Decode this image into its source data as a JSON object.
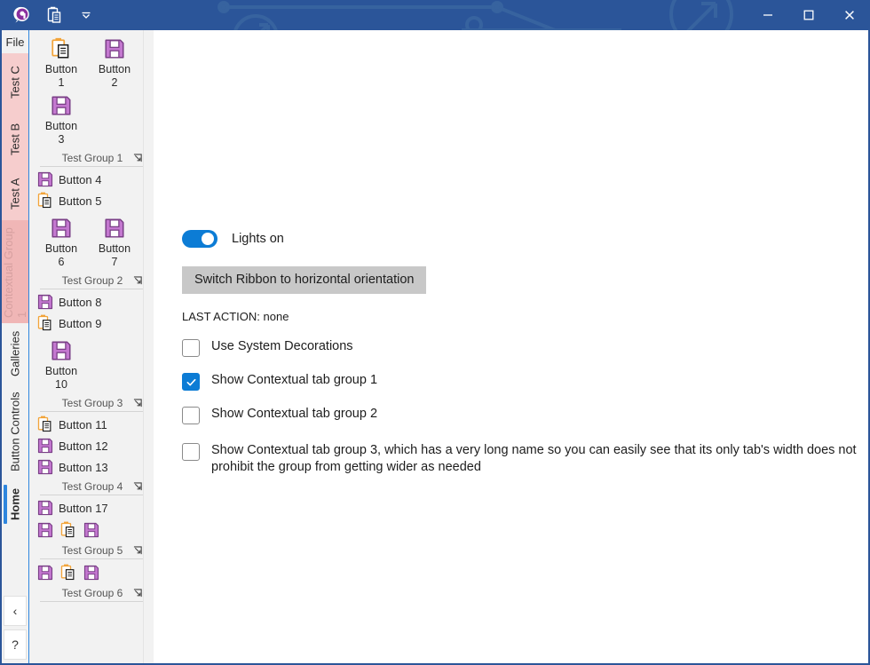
{
  "titlebar": {
    "app_icon": "app-logo-icon",
    "buttons": [
      {
        "name": "paste-icon",
        "icon": "clipboard"
      },
      {
        "name": "customize-quick-access-chevron-icon",
        "icon": "chevron-down"
      }
    ],
    "window_controls": [
      {
        "name": "minimize-button",
        "glyph": "—"
      },
      {
        "name": "maximize-button",
        "glyph": "☐"
      },
      {
        "name": "close-button",
        "glyph": "✕"
      }
    ],
    "accent_color": "#2b5599"
  },
  "ribbon": {
    "file_tab": "File",
    "tabs": [
      {
        "label": "Test C",
        "style": "pink",
        "selected": false
      },
      {
        "label": "Test B",
        "style": "pink",
        "selected": false
      },
      {
        "label": "Test A",
        "style": "pink",
        "selected": false
      },
      {
        "label": "Contextual Group 1",
        "style": "ctx",
        "selected": false
      },
      {
        "label": "Galleries",
        "style": "plain",
        "selected": false
      },
      {
        "label": "Button Controls",
        "style": "plain",
        "selected": false
      },
      {
        "label": "Home",
        "style": "plain",
        "selected": true
      }
    ],
    "bottom_buttons": [
      {
        "name": "collapse-ribbon-button",
        "glyph": "‹"
      },
      {
        "name": "help-button",
        "glyph": "?"
      }
    ],
    "groups": [
      {
        "title": "Test Group 1",
        "big_buttons": [
          {
            "label_line1": "Button",
            "label_line2": "1",
            "icon": "clipboard"
          },
          {
            "label_line1": "Button",
            "label_line2": "2",
            "icon": "floppy"
          },
          {
            "label_line1": "Button",
            "label_line2": "3",
            "icon": "floppy"
          }
        ],
        "small_buttons": [],
        "icon_rows": []
      },
      {
        "title": "Test Group 2",
        "small_buttons": [
          {
            "label": "Button 4",
            "icon": "floppy"
          },
          {
            "label": "Button 5",
            "icon": "clipboard"
          }
        ],
        "big_buttons": [
          {
            "label_line1": "Button",
            "label_line2": "6",
            "icon": "floppy"
          },
          {
            "label_line1": "Button",
            "label_line2": "7",
            "icon": "floppy"
          }
        ],
        "icon_rows": []
      },
      {
        "title": "Test Group 3",
        "small_buttons": [
          {
            "label": "Button 8",
            "icon": "floppy"
          },
          {
            "label": "Button 9",
            "icon": "clipboard"
          }
        ],
        "big_buttons": [
          {
            "label_line1": "Button",
            "label_line2": "10",
            "icon": "floppy"
          }
        ],
        "icon_rows": []
      },
      {
        "title": "Test Group 4",
        "small_buttons": [
          {
            "label": "Button 11",
            "icon": "clipboard"
          },
          {
            "label": "Button 12",
            "icon": "floppy"
          },
          {
            "label": "Button 13",
            "icon": "floppy"
          }
        ],
        "big_buttons": [],
        "icon_rows": []
      },
      {
        "title": "Test Group 5",
        "icon_rows": [
          [
            "floppy",
            "clipboard",
            "floppy"
          ]
        ],
        "small_buttons": [
          {
            "label": "Button 17",
            "icon": "floppy"
          }
        ],
        "big_buttons": []
      },
      {
        "title": "Test Group 6",
        "icon_rows": [
          [
            "floppy",
            "clipboard",
            "floppy"
          ]
        ],
        "small_buttons": [],
        "big_buttons": []
      }
    ]
  },
  "content": {
    "toggle": {
      "label": "Lights on",
      "checked": true,
      "color": "#0c7cd5"
    },
    "switch_button": "Switch Ribbon to horizontal orientation",
    "last_action": "LAST ACTION: none",
    "checkboxes": [
      {
        "label": "Use System Decorations",
        "checked": false
      },
      {
        "label": "Show Contextual tab group 1",
        "checked": true
      },
      {
        "label": "Show Contextual tab group 2",
        "checked": false
      },
      {
        "label": "Show Contextual tab group 3, which has a very long name so you can easily see that its only tab's width does not prohibit the group from getting wider as needed",
        "checked": false
      }
    ]
  }
}
